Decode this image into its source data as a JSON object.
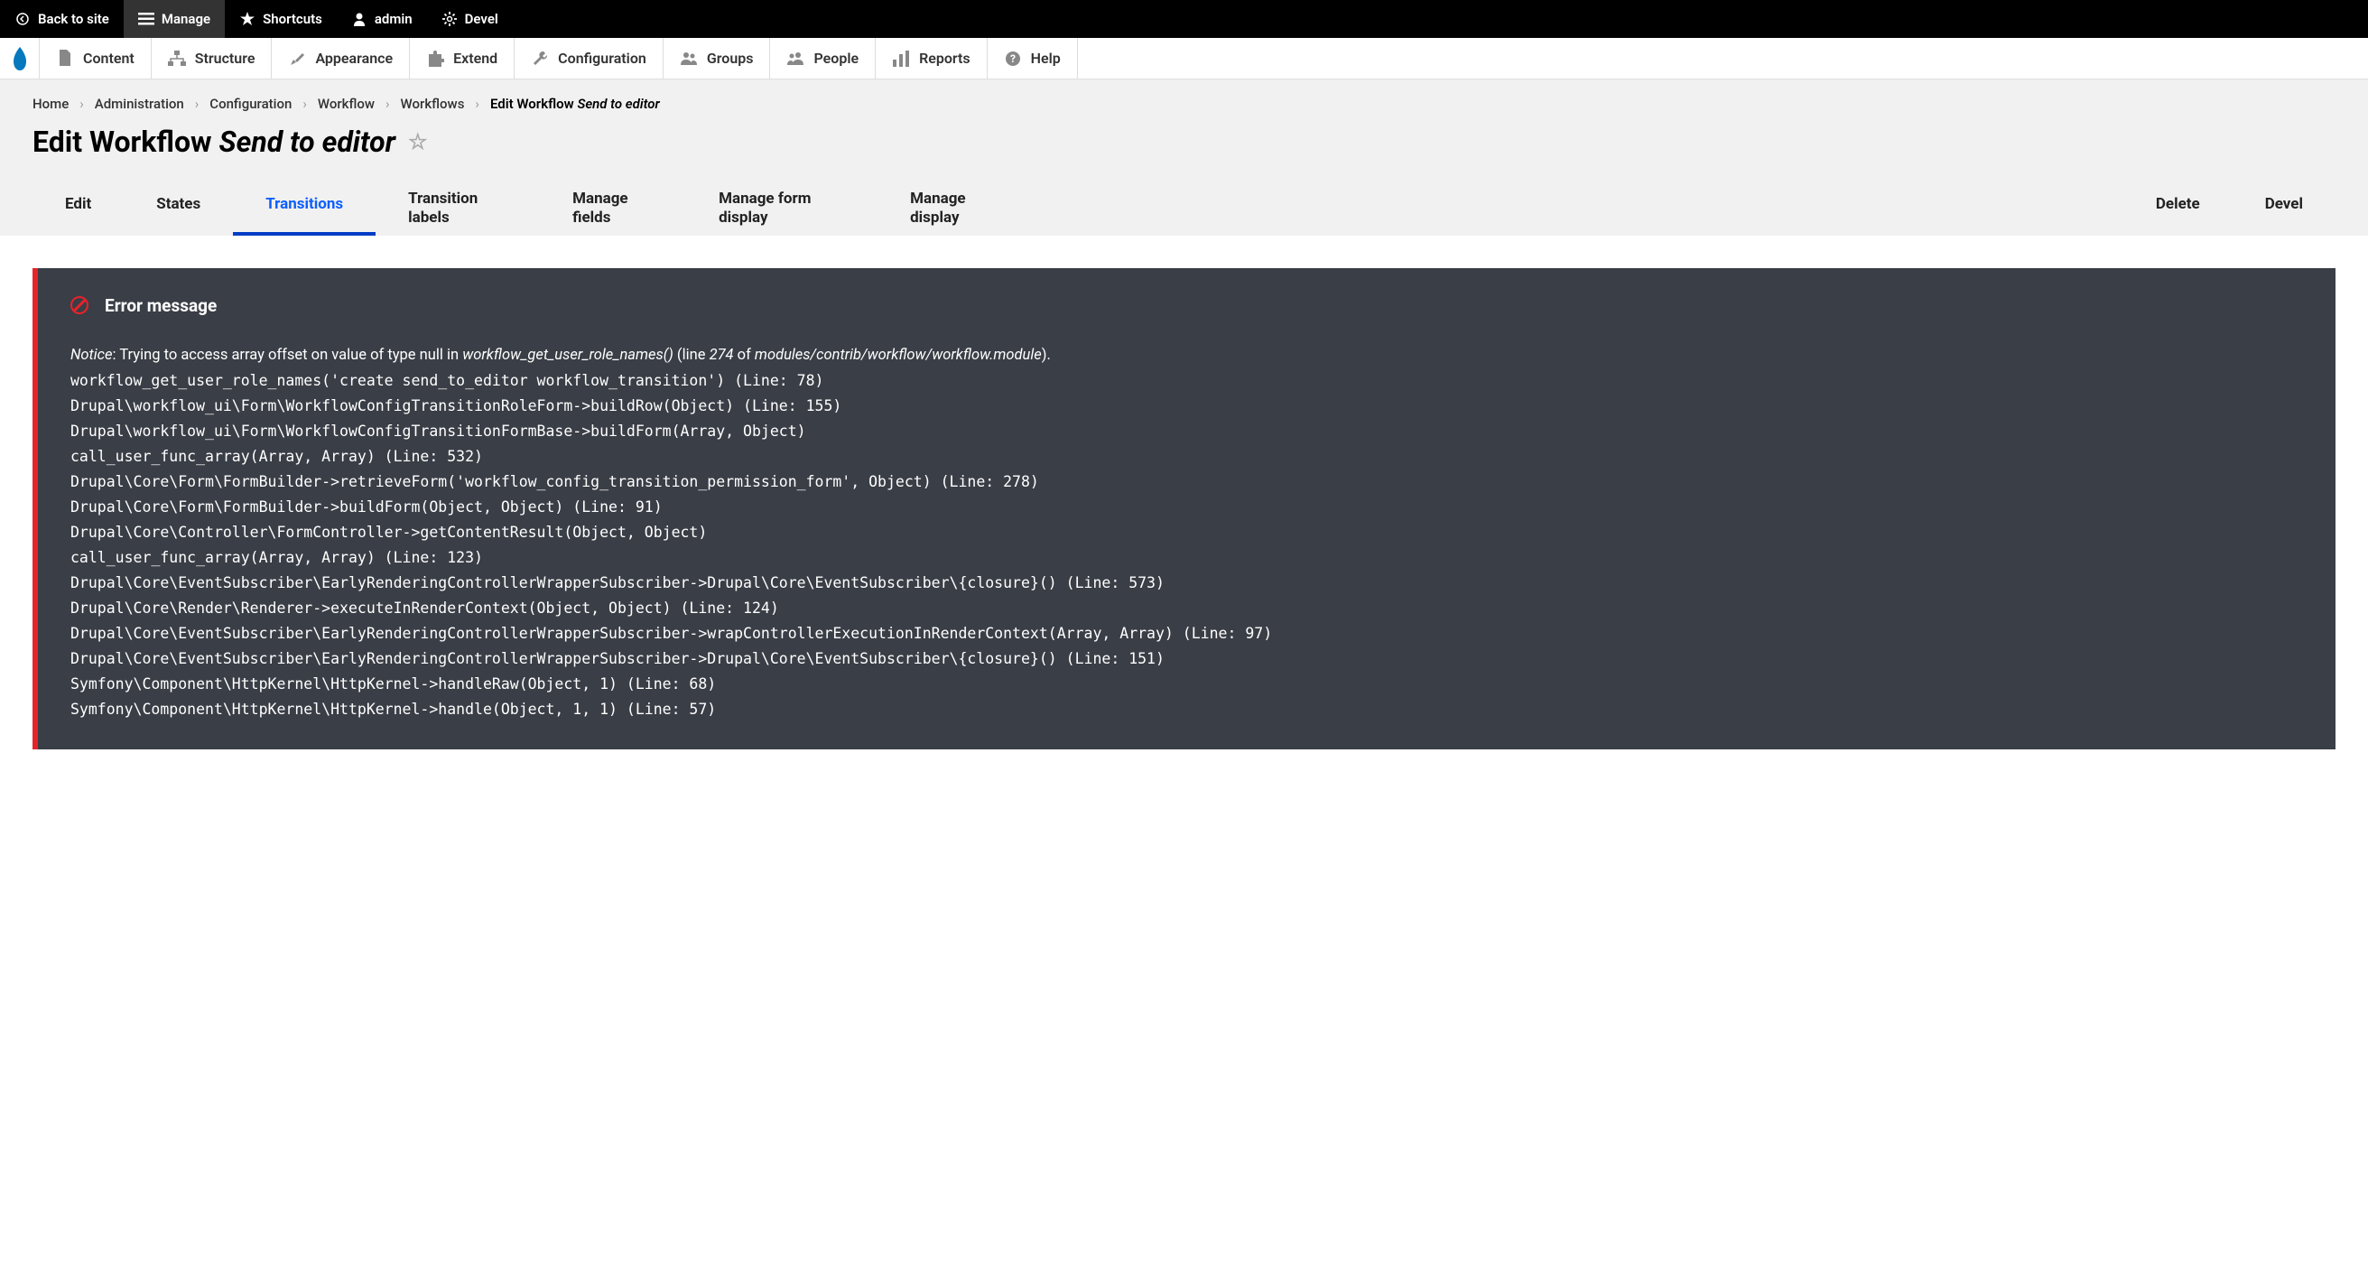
{
  "top_toolbar": {
    "back_to_site": "Back to site",
    "manage": "Manage",
    "shortcuts": "Shortcuts",
    "admin": "admin",
    "devel": "Devel"
  },
  "admin_menu": {
    "content": "Content",
    "structure": "Structure",
    "appearance": "Appearance",
    "extend": "Extend",
    "configuration": "Configuration",
    "groups": "Groups",
    "people": "People",
    "reports": "Reports",
    "help": "Help"
  },
  "breadcrumb": {
    "home": "Home",
    "administration": "Administration",
    "configuration": "Configuration",
    "workflow": "Workflow",
    "workflows": "Workflows",
    "current_prefix": "Edit Workflow",
    "current_em": "Send to editor"
  },
  "page_title": {
    "prefix": "Edit Workflow",
    "em": "Send to editor"
  },
  "tabs": {
    "edit": "Edit",
    "states": "States",
    "transitions": "Transitions",
    "transition_labels": "Transition labels",
    "manage_fields": "Manage fields",
    "manage_form_display": "Manage form display",
    "manage_display": "Manage display",
    "delete": "Delete",
    "devel": "Devel"
  },
  "error": {
    "title": "Error message",
    "notice_label": "Notice",
    "notice_text": ": Trying to access array offset on value of type null in ",
    "notice_func": "workflow_get_user_role_names()",
    "notice_line_prefix": " (line ",
    "notice_line_num": "274",
    "notice_of": " of ",
    "notice_file": "modules/contrib/workflow/workflow.module",
    "notice_close": ").",
    "trace": "workflow_get_user_role_names('create send_to_editor workflow_transition') (Line: 78)\nDrupal\\workflow_ui\\Form\\WorkflowConfigTransitionRoleForm->buildRow(Object) (Line: 155)\nDrupal\\workflow_ui\\Form\\WorkflowConfigTransitionFormBase->buildForm(Array, Object)\ncall_user_func_array(Array, Array) (Line: 532)\nDrupal\\Core\\Form\\FormBuilder->retrieveForm('workflow_config_transition_permission_form', Object) (Line: 278)\nDrupal\\Core\\Form\\FormBuilder->buildForm(Object, Object) (Line: 91)\nDrupal\\Core\\Controller\\FormController->getContentResult(Object, Object)\ncall_user_func_array(Array, Array) (Line: 123)\nDrupal\\Core\\EventSubscriber\\EarlyRenderingControllerWrapperSubscriber->Drupal\\Core\\EventSubscriber\\{closure}() (Line: 573)\nDrupal\\Core\\Render\\Renderer->executeInRenderContext(Object, Object) (Line: 124)\nDrupal\\Core\\EventSubscriber\\EarlyRenderingControllerWrapperSubscriber->wrapControllerExecutionInRenderContext(Array, Array) (Line: 97)\nDrupal\\Core\\EventSubscriber\\EarlyRenderingControllerWrapperSubscriber->Drupal\\Core\\EventSubscriber\\{closure}() (Line: 151)\nSymfony\\Component\\HttpKernel\\HttpKernel->handleRaw(Object, 1) (Line: 68)\nSymfony\\Component\\HttpKernel\\HttpKernel->handle(Object, 1, 1) (Line: 57)"
  }
}
